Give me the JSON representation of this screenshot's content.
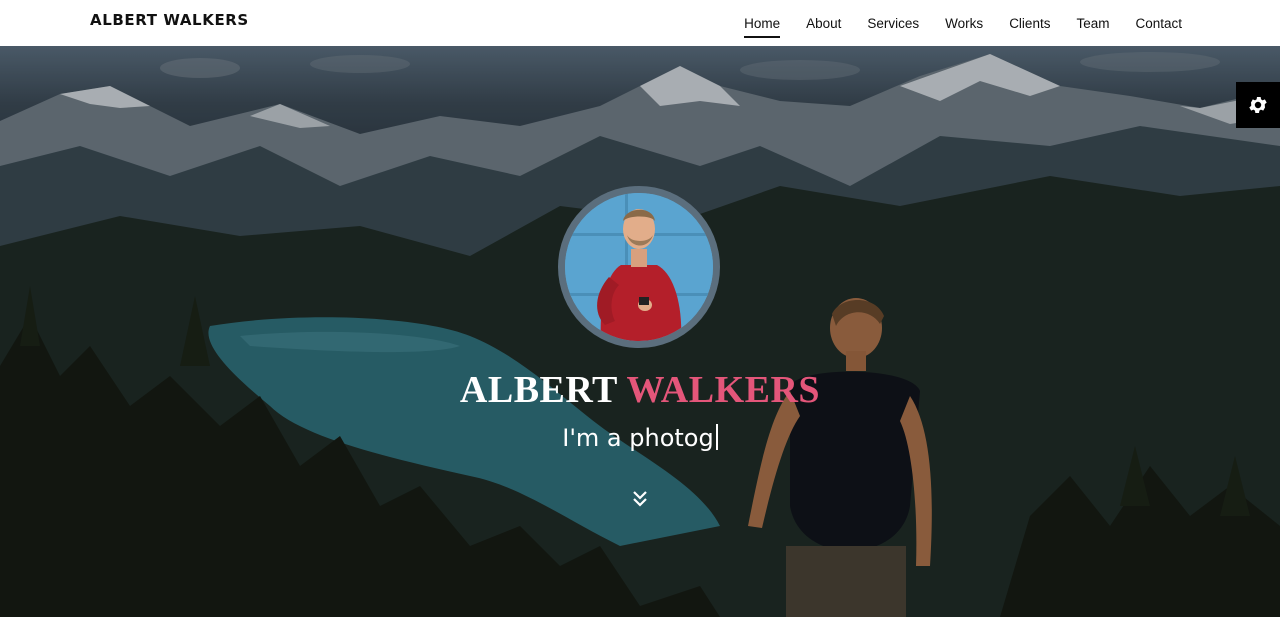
{
  "header": {
    "brand": "ALBERT WALKERS",
    "nav": [
      {
        "label": "Home",
        "active": true
      },
      {
        "label": "About",
        "active": false
      },
      {
        "label": "Services",
        "active": false
      },
      {
        "label": "Works",
        "active": false
      },
      {
        "label": "Clients",
        "active": false
      },
      {
        "label": "Team",
        "active": false
      },
      {
        "label": "Contact",
        "active": false
      }
    ]
  },
  "hero": {
    "name_first": "ALBERT",
    "name_last": "WALKERS",
    "tagline": "I'm a photog",
    "accent_color": "#e4567a"
  },
  "icons": {
    "settings": "gear-icon",
    "scroll": "double-chevron-down-icon"
  }
}
